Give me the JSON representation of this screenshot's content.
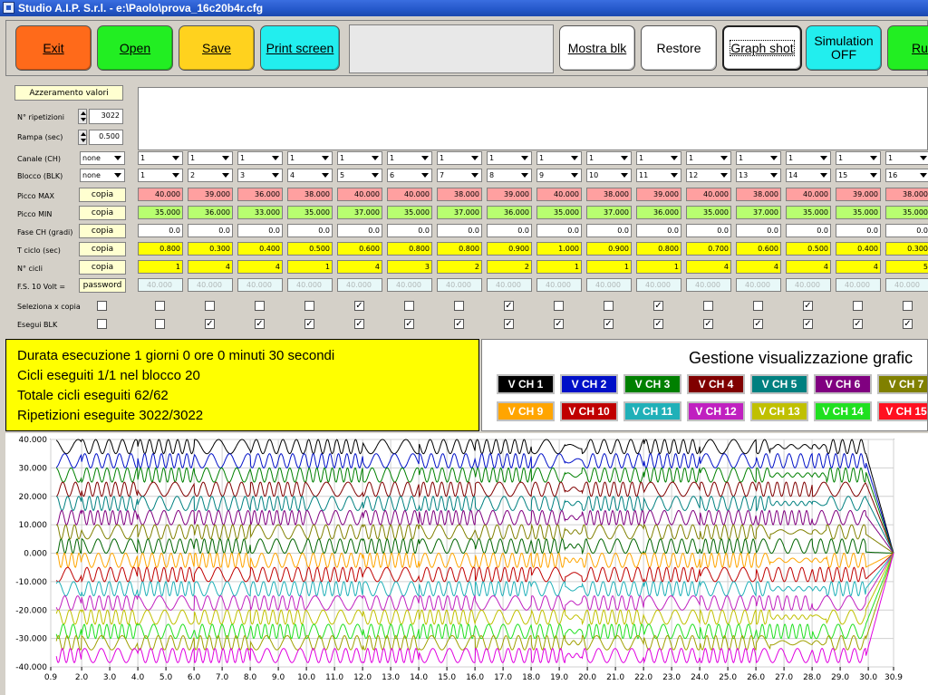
{
  "window": {
    "title": "Studio A.I.P. S.r.l. - e:\\Paolo\\prova_16c20b4r.cfg"
  },
  "toolbar": {
    "buttons": [
      {
        "label": "Exit",
        "color": "#ff6a1a"
      },
      {
        "label": "Open",
        "color": "#22ee22"
      },
      {
        "label": "Save",
        "color": "#ffd21e"
      },
      {
        "label": "Print screen",
        "color": "#22eeee"
      },
      {
        "label": "Mostra blk",
        "color": "#ffffff"
      },
      {
        "label": "Restore",
        "color": "#ffffff"
      },
      {
        "label": "Graph shot",
        "color": "#ffffff"
      },
      {
        "label": "Simulation OFF",
        "color": "#22eeee"
      },
      {
        "label": "Ru",
        "color": "#22ee22"
      }
    ]
  },
  "config": {
    "reset_label": "Azzeramento valori",
    "repetitions": {
      "label": "N° ripetizioni",
      "value": "3022"
    },
    "ramp": {
      "label": "Rampa (sec)",
      "value": "0.500"
    },
    "row_labels": {
      "canale": "Canale (CH)",
      "blocco": "Blocco (BLK)",
      "picco_max": "Picco MAX",
      "picco_min": "Picco MIN",
      "fase": "Fase CH (gradi)",
      "tciclo": "T ciclo (sec)",
      "ncicli": "N° cicli",
      "fs": "F.S. 10 Volt =",
      "seleziona": "Seleziona x copia",
      "esegui": "Esegui BLK"
    },
    "canale_combo": "none",
    "blocco_combo": "none",
    "copy_label": "copia",
    "password_label": "password",
    "fs_placeholder": "40.000",
    "channels": [
      {
        "ch": "1",
        "blk": "1",
        "max": "40.000",
        "min": "35.000",
        "fase": "0.0",
        "tc": "0.800",
        "nc": "1",
        "sel": false,
        "esegui": false
      },
      {
        "ch": "1",
        "blk": "2",
        "max": "39.000",
        "min": "36.000",
        "fase": "0.0",
        "tc": "0.300",
        "nc": "4",
        "sel": false,
        "esegui": true
      },
      {
        "ch": "1",
        "blk": "3",
        "max": "36.000",
        "min": "33.000",
        "fase": "0.0",
        "tc": "0.400",
        "nc": "4",
        "sel": false,
        "esegui": true
      },
      {
        "ch": "1",
        "blk": "4",
        "max": "38.000",
        "min": "35.000",
        "fase": "0.0",
        "tc": "0.500",
        "nc": "1",
        "sel": false,
        "esegui": true
      },
      {
        "ch": "1",
        "blk": "5",
        "max": "40.000",
        "min": "37.000",
        "fase": "0.0",
        "tc": "0.600",
        "nc": "4",
        "sel": true,
        "esegui": true
      },
      {
        "ch": "1",
        "blk": "6",
        "max": "40.000",
        "min": "35.000",
        "fase": "0.0",
        "tc": "0.800",
        "nc": "3",
        "sel": false,
        "esegui": true
      },
      {
        "ch": "1",
        "blk": "7",
        "max": "38.000",
        "min": "37.000",
        "fase": "0.0",
        "tc": "0.800",
        "nc": "2",
        "sel": false,
        "esegui": true
      },
      {
        "ch": "1",
        "blk": "8",
        "max": "39.000",
        "min": "36.000",
        "fase": "0.0",
        "tc": "0.900",
        "nc": "2",
        "sel": true,
        "esegui": true
      },
      {
        "ch": "1",
        "blk": "9",
        "max": "40.000",
        "min": "35.000",
        "fase": "0.0",
        "tc": "1.000",
        "nc": "1",
        "sel": false,
        "esegui": true
      },
      {
        "ch": "1",
        "blk": "10",
        "max": "38.000",
        "min": "37.000",
        "fase": "0.0",
        "tc": "0.900",
        "nc": "1",
        "sel": false,
        "esegui": true
      },
      {
        "ch": "1",
        "blk": "11",
        "max": "39.000",
        "min": "36.000",
        "fase": "0.0",
        "tc": "0.800",
        "nc": "1",
        "sel": true,
        "esegui": true
      },
      {
        "ch": "1",
        "blk": "12",
        "max": "40.000",
        "min": "35.000",
        "fase": "0.0",
        "tc": "0.700",
        "nc": "4",
        "sel": false,
        "esegui": true
      },
      {
        "ch": "1",
        "blk": "13",
        "max": "38.000",
        "min": "37.000",
        "fase": "0.0",
        "tc": "0.600",
        "nc": "4",
        "sel": false,
        "esegui": true
      },
      {
        "ch": "1",
        "blk": "14",
        "max": "40.000",
        "min": "35.000",
        "fase": "0.0",
        "tc": "0.500",
        "nc": "4",
        "sel": true,
        "esegui": true
      },
      {
        "ch": "1",
        "blk": "15",
        "max": "39.000",
        "min": "35.000",
        "fase": "0.0",
        "tc": "0.400",
        "nc": "4",
        "sel": false,
        "esegui": true
      },
      {
        "ch": "1",
        "blk": "16",
        "max": "38.000",
        "min": "35.000",
        "fase": "0.0",
        "tc": "0.300",
        "nc": "5",
        "sel": false,
        "esegui": true
      }
    ]
  },
  "info": {
    "lines": [
      "Durata esecuzione 1 giorni 0 ore 0 minuti 30 secondi",
      "Cicli eseguiti 1/1 nel blocco 20",
      "Totale cicli eseguiti 62/62",
      "Ripetizioni eseguite 3022/3022"
    ]
  },
  "gestione": {
    "title": "Gestione visualizzazione grafic",
    "channels": [
      {
        "label": "V CH 1",
        "color": "#000000"
      },
      {
        "label": "V CH 2",
        "color": "#0010c8"
      },
      {
        "label": "V CH 3",
        "color": "#008000"
      },
      {
        "label": "V CH 4",
        "color": "#800000"
      },
      {
        "label": "V CH 5",
        "color": "#008080"
      },
      {
        "label": "V CH 6",
        "color": "#800080"
      },
      {
        "label": "V CH 7",
        "color": "#808000"
      },
      {
        "label": "V CH 9",
        "color": "#ffa500"
      },
      {
        "label": "V CH 10",
        "color": "#c00000"
      },
      {
        "label": "V CH 11",
        "color": "#20b0b8"
      },
      {
        "label": "V CH 12",
        "color": "#c020c0"
      },
      {
        "label": "V CH 13",
        "color": "#c0c000"
      },
      {
        "label": "V CH 14",
        "color": "#20e020"
      },
      {
        "label": "V CH 15",
        "color": "#ff1020"
      }
    ]
  },
  "chart_data": {
    "type": "line",
    "ylim": [
      -40,
      40
    ],
    "xlim": [
      0.9,
      30.9
    ],
    "y_ticks": [
      "40.000",
      "30.000",
      "20.000",
      "10.000",
      "0.000",
      "-10.000",
      "-20.000",
      "-30.000",
      "-40.000"
    ],
    "x_ticks": [
      "0.9",
      "2.0",
      "3.0",
      "4.0",
      "5.0",
      "6.0",
      "7.0",
      "8.0",
      "9.0",
      "10.0",
      "11.0",
      "12.0",
      "13.0",
      "14.0",
      "15.0",
      "16.0",
      "17.0",
      "18.0",
      "19.0",
      "20.0",
      "21.0",
      "22.0",
      "23.0",
      "24.0",
      "25.0",
      "26.0",
      "27.0",
      "28.0",
      "29.0",
      "30.0",
      "30.9"
    ],
    "grid": true,
    "series": [
      {
        "color": "#000000",
        "base": 37.5,
        "amp": 2.5
      },
      {
        "color": "#0010c8",
        "base": 32.5,
        "amp": 2.5
      },
      {
        "color": "#008000",
        "base": 27.5,
        "amp": 2.5
      },
      {
        "color": "#800000",
        "base": 22.5,
        "amp": 2.5
      },
      {
        "color": "#008080",
        "base": 17.5,
        "amp": 2.5
      },
      {
        "color": "#800080",
        "base": 12.5,
        "amp": 2.5
      },
      {
        "color": "#808000",
        "base": 7.5,
        "amp": 2.5
      },
      {
        "color": "#006400",
        "base": 2.5,
        "amp": 2.5
      },
      {
        "color": "#ffa500",
        "base": -2.5,
        "amp": 2.5
      },
      {
        "color": "#c00000",
        "base": -7.5,
        "amp": 2.5
      },
      {
        "color": "#20b0b8",
        "base": -12.5,
        "amp": 2.5
      },
      {
        "color": "#c020c0",
        "base": -17.5,
        "amp": 2.5
      },
      {
        "color": "#c0c000",
        "base": -22.5,
        "amp": 2.5
      },
      {
        "color": "#20e020",
        "base": -27.5,
        "amp": 2.5
      },
      {
        "color": "#a0a000",
        "base": -31.5,
        "amp": 2.5
      },
      {
        "color": "#e000e0",
        "base": -36.0,
        "amp": 2.5
      }
    ]
  }
}
